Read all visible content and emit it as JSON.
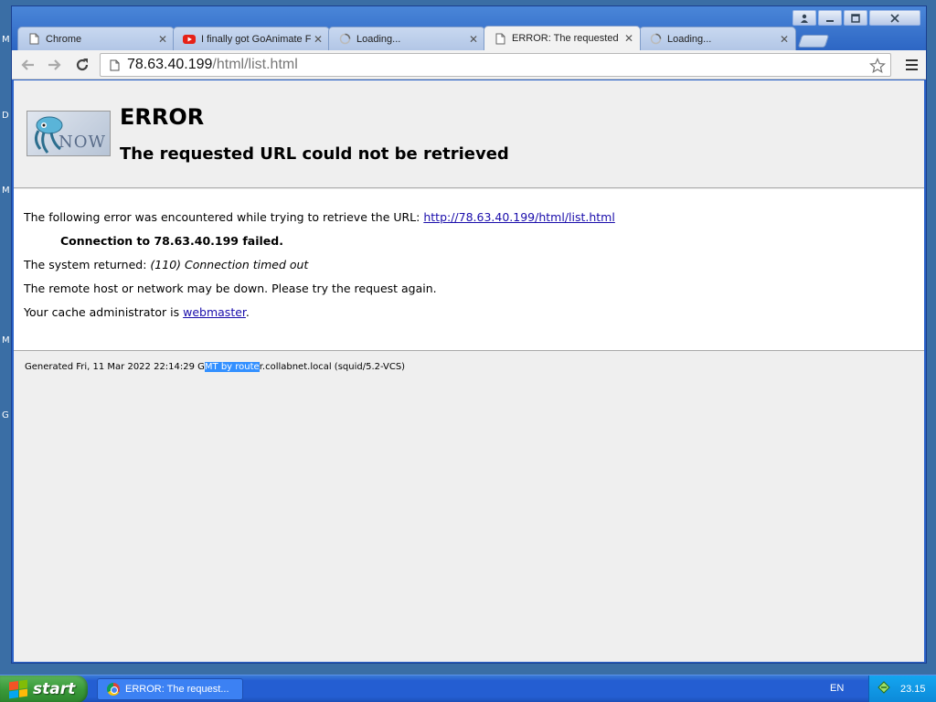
{
  "desktop": {
    "edge_letters": [
      "M",
      "D",
      "M",
      "M",
      "G"
    ]
  },
  "browser": {
    "tabs": [
      {
        "label": "Chrome",
        "icon": "page-icon",
        "active": false
      },
      {
        "label": "I finally got GoAnimate F",
        "icon": "youtube-icon",
        "active": false
      },
      {
        "label": "Loading...",
        "icon": "loading-spinner-icon",
        "active": false
      },
      {
        "label": "ERROR: The requested",
        "icon": "page-icon",
        "active": true
      },
      {
        "label": "Loading...",
        "icon": "loading-spinner-icon",
        "active": false
      }
    ],
    "address": {
      "host": "78.63.40.199",
      "path": "/html/list.html"
    }
  },
  "page": {
    "title": "ERROR",
    "subtitle": "The requested URL could not be retrieved",
    "logo_text": "NOW",
    "error_intro": "The following error was encountered while trying to retrieve the URL: ",
    "error_url": "http://78.63.40.199/html/list.html",
    "failure": "Connection to 78.63.40.199 failed.",
    "system_prefix": "The system returned: ",
    "system_message": "(110) Connection timed out",
    "advice": "The remote host or network may be down. Please try the request again.",
    "admin_prefix": "Your cache administrator is ",
    "admin_link": "webmaster",
    "admin_suffix": ".",
    "footer_before": "Generated Fri, 11 Mar 2022 22:14:29 G",
    "footer_selected": "MT by route",
    "footer_after": "r.collabnet.local (squid/5.2-VCS)"
  },
  "taskbar": {
    "start_label": "start",
    "task_label": "ERROR: The request...",
    "language": "EN",
    "clock": "23.15"
  },
  "colors": {
    "link": "#1a0dab",
    "selection": "#3390ff",
    "taskbar": "#245ed2",
    "start": "#3a9a3a"
  }
}
